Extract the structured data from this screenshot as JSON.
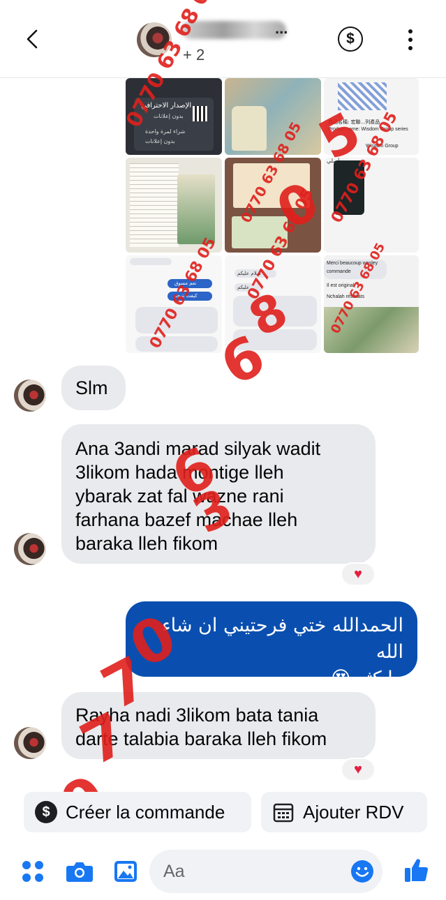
{
  "header": {
    "participants_label": "+ 2",
    "name_visible": "..."
  },
  "collage": {
    "watermark_numbers": [
      "0770 63 68 05",
      "0770 63 68 05",
      "0770 63 68 05",
      "0770 63 68 05",
      "0770 63 68 05",
      "0770 63 68 05"
    ],
    "tile_texts": {
      "t1_title": "الإصدار الاحترافي",
      "t1_sub": "بدون إعلانات",
      "t1_line1": "شراء لمرة واحدة",
      "t1_line2": "بدون إعلانات",
      "t3_line1": "商品名稱: 宏聯...列產品",
      "t3_line2": "Product name: Wisdom Group series",
      "t3_line3": "Wisdom Group",
      "t6_label": "أصلي",
      "t7_badge1": "نعم مسوق",
      "t7_badge2": "كيفت نتيجة",
      "t8_line1": "سلام عليكم",
      "t8_line2": "عليكم",
      "t9_line1": "Merci beaucoup wesley",
      "t9_line2": "commande",
      "t9_line3": "Il est original",
      "t9_line4": "Nchalah       résultats"
    }
  },
  "messages": [
    {
      "direction": "in",
      "text": "Slm"
    },
    {
      "direction": "in",
      "lines": [
        "Ana 3andi marad silyak wadit",
        "3likom hada montige lleh",
        "ybarak zat fal wazne rani",
        "farhana bazef machae lleh",
        "baraka lleh fikom"
      ],
      "reaction": "♥"
    },
    {
      "direction": "out",
      "lines": [
        "الحمدالله ختي فرحتيني ان شاء الله",
        "ما كثر 😍"
      ]
    },
    {
      "direction": "in",
      "lines": [
        "Rayha nadi 3likom bata tania",
        "darte talabia baraka lleh fikom"
      ],
      "reaction": "♥"
    }
  ],
  "overlay_marks": [
    "6",
    "8",
    "0",
    "5",
    "6",
    "3",
    "0",
    "7",
    "7",
    "0"
  ],
  "actions": {
    "create_order": "Créer la commande",
    "add_appointment": "Ajouter RDV"
  },
  "composer": {
    "placeholder": "Aa"
  },
  "icons": [
    "back-arrow-icon",
    "dollar-icon",
    "more-vertical-icon",
    "apps-grid-icon",
    "camera-icon",
    "gallery-icon",
    "emoji-icon",
    "thumbs-up-icon",
    "heart-icon",
    "calendar-icon"
  ],
  "colors": {
    "accent": "#1877f2",
    "outgoing_bubble": "#0a4fb0",
    "incoming_bubble": "#e9eaed",
    "watermark": "#e0201c",
    "heart": "#e41e3f"
  }
}
